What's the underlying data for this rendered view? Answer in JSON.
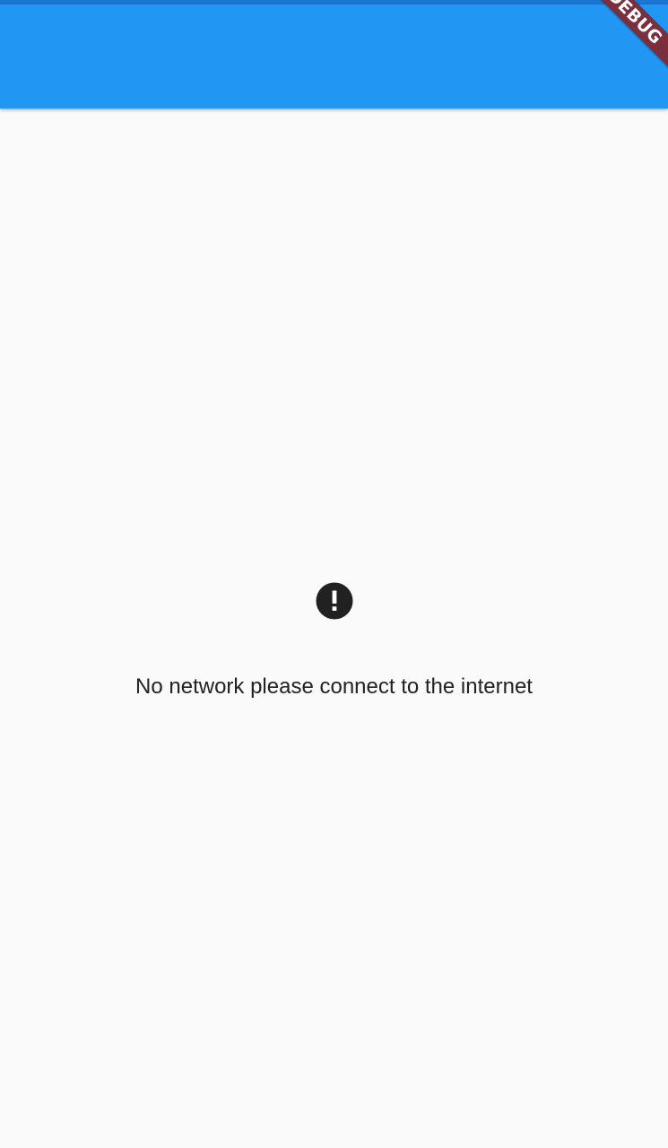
{
  "app_bar": {
    "title": "",
    "color": "#2196f3"
  },
  "status_bar": {
    "color": "#1976d2"
  },
  "debug_banner": {
    "label": "DEBUG"
  },
  "content": {
    "icon": "error-icon",
    "message": "No network please connect to the internet"
  }
}
